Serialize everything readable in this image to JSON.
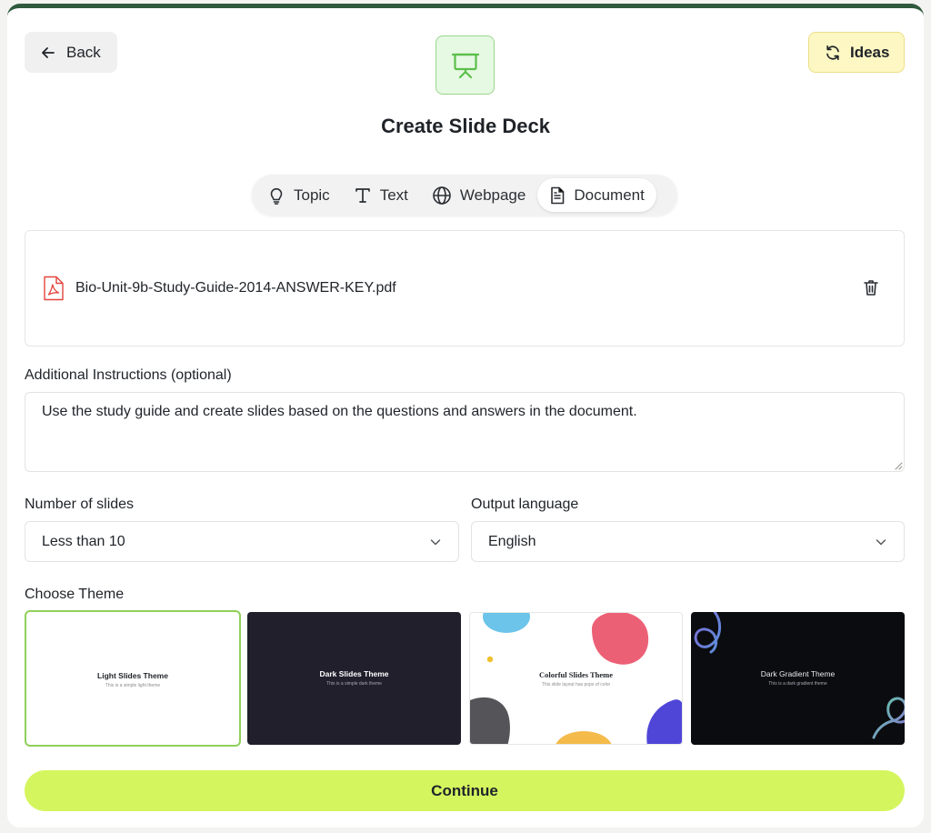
{
  "header": {
    "back_label": "Back",
    "ideas_label": "Ideas",
    "title": "Create Slide Deck"
  },
  "tabs": [
    {
      "label": "Topic",
      "icon": "lightbulb-icon",
      "active": false
    },
    {
      "label": "Text",
      "icon": "text-icon",
      "active": false
    },
    {
      "label": "Webpage",
      "icon": "globe-icon",
      "active": false
    },
    {
      "label": "Document",
      "icon": "document-icon",
      "active": true
    }
  ],
  "upload": {
    "file_name": "Bio-Unit-9b-Study-Guide-2014-ANSWER-KEY.pdf"
  },
  "instructions": {
    "label": "Additional Instructions (optional)",
    "value": "Use the study guide and create slides based on the questions and answers in the document."
  },
  "slides_count": {
    "label": "Number of slides",
    "value": "Less than 10"
  },
  "language": {
    "label": "Output language",
    "value": "English"
  },
  "themes": {
    "label": "Choose Theme",
    "items": [
      {
        "title": "Light Slides Theme",
        "subtitle": "This is a simple light theme",
        "selected": true
      },
      {
        "title": "Dark Slides Theme",
        "subtitle": "This is a simple dark theme",
        "selected": false
      },
      {
        "title": "Colorful Slides Theme",
        "subtitle": "This slide layout has pops of color",
        "selected": false
      },
      {
        "title": "Dark Gradient Theme",
        "subtitle": "This is a dark gradient theme",
        "selected": false
      }
    ]
  },
  "continue_label": "Continue",
  "colors": {
    "header_bar": "#2f5a3e",
    "ideas_bg": "#fdf7c3",
    "hero_icon_bg": "#e6f9e2",
    "hero_icon_stroke": "#5bbf4b",
    "selected_theme_border": "#8fd05a",
    "continue_bg": "#d5f55f",
    "pdf_icon": "#e2453c"
  }
}
